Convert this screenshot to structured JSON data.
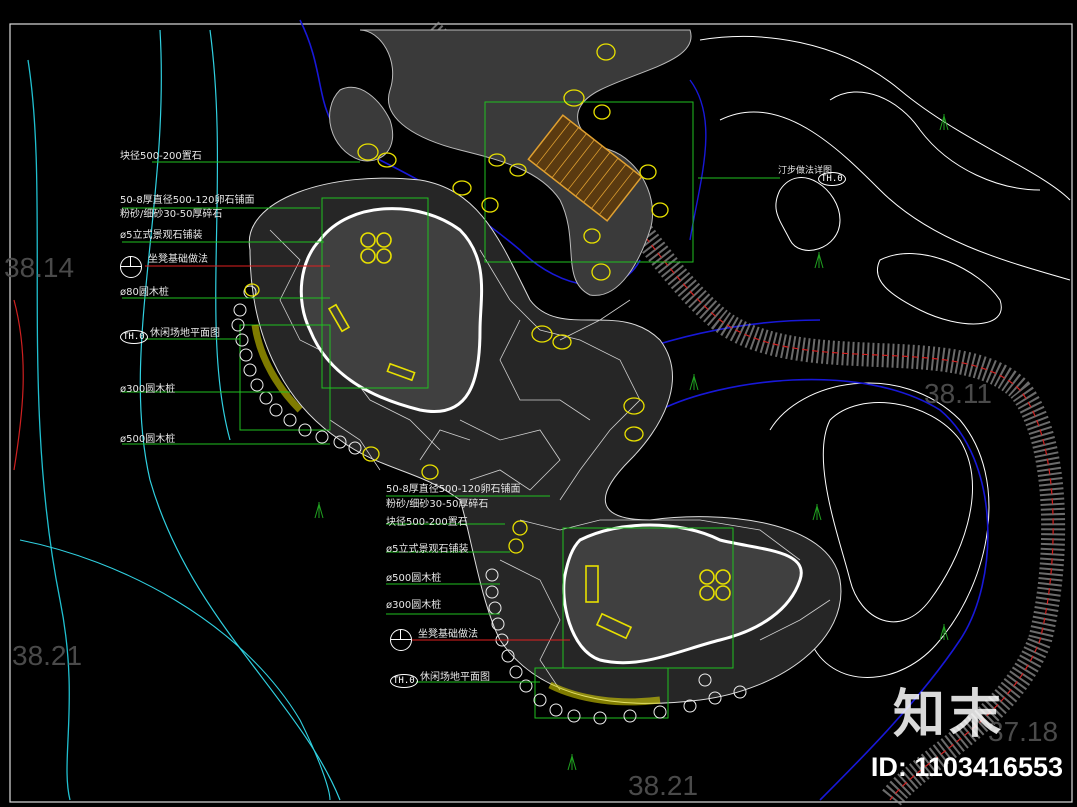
{
  "title": "",
  "labels_left": [
    "块径500-200置石",
    "50-8厚直径500-120卵石铺面",
    "粉砂/细砂30-50厚碎石",
    "ø5立式景观石铺装",
    "坐凳基础做法",
    "ø80圆木桩",
    "休闲场地平面图",
    "ø300圆木桩",
    "ø500圆木桩"
  ],
  "labels_center": [
    "50-8厚直径500-120卵石铺面",
    "粉砂/细砂30-50厚碎石",
    "块径500-200置石",
    "ø5立式景观石铺装",
    "ø500圆木桩",
    "ø300圆木桩",
    "坐凳基础做法",
    "休闲场地平面图"
  ],
  "label_right": "汀步做法详图",
  "tags": {
    "t1": "TH.0",
    "t2": "TH.0",
    "t3": "TH.0"
  },
  "elevations": [
    "38.14",
    "38.11",
    "38.21",
    "38.21",
    "37.18"
  ],
  "watermark": {
    "brand": "知末",
    "id": "ID: 1103416553"
  },
  "colors": {
    "background": "#000000",
    "contour": "#1010d0",
    "cyan": "#30d0e0",
    "green": "#20c020",
    "yellow": "#e8e000",
    "red": "#e02020",
    "white": "#ffffff"
  }
}
